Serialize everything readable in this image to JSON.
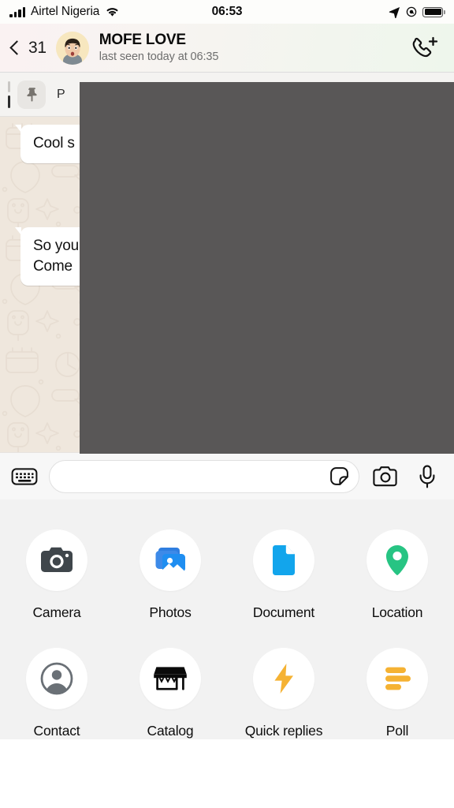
{
  "status_bar": {
    "carrier": "Airtel Nigeria",
    "time": "06:53",
    "icons": {
      "signal": "signal-bars-icon",
      "wifi": "wifi-icon",
      "location": "location-arrow-icon",
      "alarm": "alarm-icon",
      "battery": "battery-full-icon"
    }
  },
  "header": {
    "back_count": "31",
    "contact_name": "MOFE LOVE",
    "contact_status": "last seen today at 06:35",
    "avatar": "memoji-avatar",
    "call_button": "add-call-icon"
  },
  "pinned": {
    "icon": "pin-icon",
    "label": "P"
  },
  "messages": [
    {
      "text": "Cool s",
      "side": "incoming"
    },
    {
      "text": "So you\nCome",
      "side": "incoming"
    }
  ],
  "input_bar": {
    "keyboard_icon": "keyboard-icon",
    "placeholder": "",
    "value": "",
    "sticker_icon": "sticker-icon",
    "camera_icon": "camera-icon",
    "mic_icon": "microphone-icon"
  },
  "attachments": [
    {
      "label": "Camera",
      "icon": "camera-icon",
      "color": "#3f464b"
    },
    {
      "label": "Photos",
      "icon": "photos-icon",
      "color": "#1f8ef1"
    },
    {
      "label": "Document",
      "icon": "document-icon",
      "color": "#12a5ec"
    },
    {
      "label": "Location",
      "icon": "location-pin-icon",
      "color": "#27c483"
    },
    {
      "label": "Contact",
      "icon": "contact-icon",
      "color": "#6a7076"
    },
    {
      "label": "Catalog",
      "icon": "catalog-icon",
      "color": "#0a0a0a"
    },
    {
      "label": "Quick replies",
      "icon": "lightning-icon",
      "color": "#f5b233"
    },
    {
      "label": "Poll",
      "icon": "poll-icon",
      "color": "#f5b233"
    }
  ],
  "colors": {
    "chat_background": "#efe7dd",
    "bubble_incoming": "#ffffff",
    "panel_background": "#f2f2f2",
    "occluder": "#595757"
  }
}
